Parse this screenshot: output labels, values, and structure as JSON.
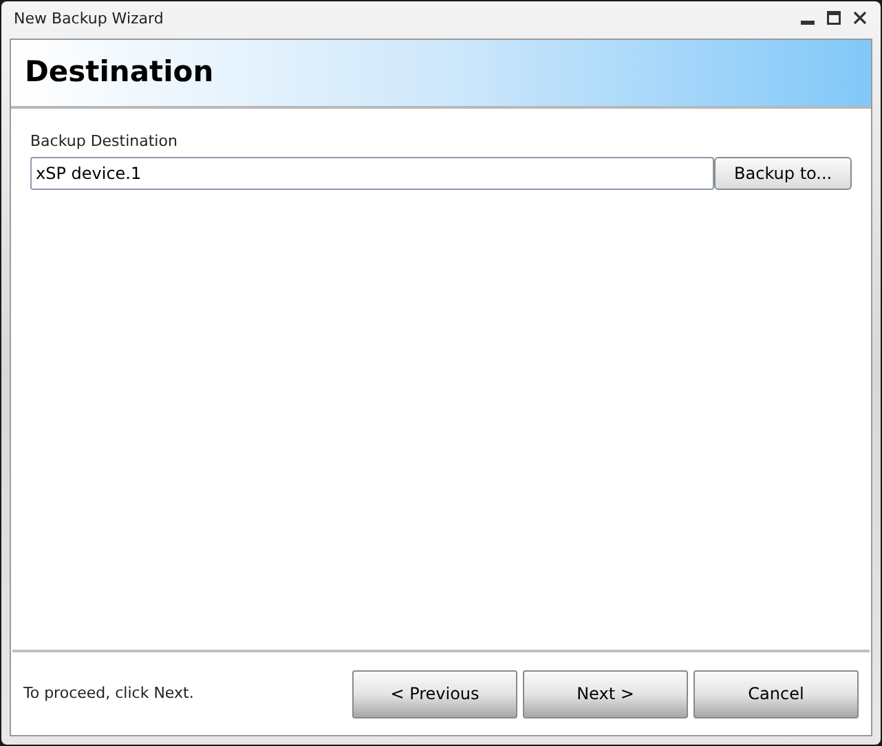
{
  "window": {
    "title": "New Backup Wizard"
  },
  "header": {
    "title": "Destination"
  },
  "destination": {
    "label": "Backup Destination",
    "value": "xSP device.1",
    "browse_button": "Backup to..."
  },
  "footer": {
    "hint": "To proceed, click Next.",
    "buttons": [
      "< Previous",
      "Next >",
      "Cancel"
    ]
  }
}
